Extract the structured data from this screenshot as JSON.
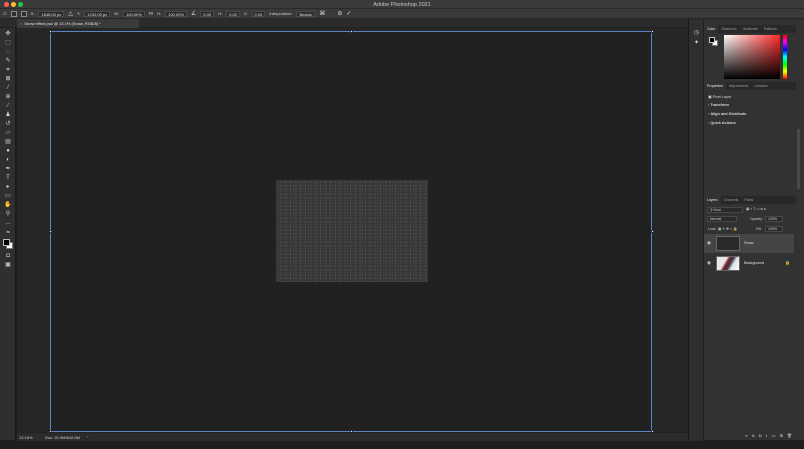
{
  "app": {
    "title": "Adobe Photoshop 2021"
  },
  "options_bar": {
    "x_label": "X:",
    "x_value": "1848.00 px",
    "y_label": "Y:",
    "y_value": "1232.00 px",
    "w_label": "W:",
    "w_value": "100.00%",
    "h_label": "H:",
    "h_value": "100.00%",
    "angle_value": "0.00",
    "h_skew_label": "H:",
    "h_skew_value": "0.00",
    "v_skew_label": "V:",
    "v_skew_value": "0.00",
    "interpolation_label": "Interpolation:",
    "interpolation_value": "Bicubic"
  },
  "document_tab": {
    "title": "Snow effect.psd @ 13.1% (Snow, RGB/8) *"
  },
  "status_bar": {
    "zoom": "13.16%",
    "doc_info": "Doc: 20.9M/642.8M"
  },
  "color_panel": {
    "tabs": [
      "Color",
      "Swatches",
      "Gradients",
      "Patterns"
    ]
  },
  "properties_panel": {
    "tabs": [
      "Properties",
      "Adjustments",
      "Libraries"
    ],
    "type_label": "Pixel Layer",
    "sections": [
      "Transform",
      "Align and Distribute",
      "Quick Actions"
    ]
  },
  "layers_panel": {
    "tabs": [
      "Layers",
      "Channels",
      "Paths"
    ],
    "filter_kind": "Kind",
    "blend_mode": "Normal",
    "opacity_label": "Opacity:",
    "opacity_value": "100%",
    "lock_label": "Lock:",
    "fill_label": "Fill:",
    "fill_value": "100%",
    "layers": [
      {
        "name": "Snow",
        "selected": true
      },
      {
        "name": "Background",
        "selected": false
      }
    ]
  },
  "colors": {
    "selection_bounds": "#5b83c8",
    "accent_red": "#ff5f57"
  }
}
